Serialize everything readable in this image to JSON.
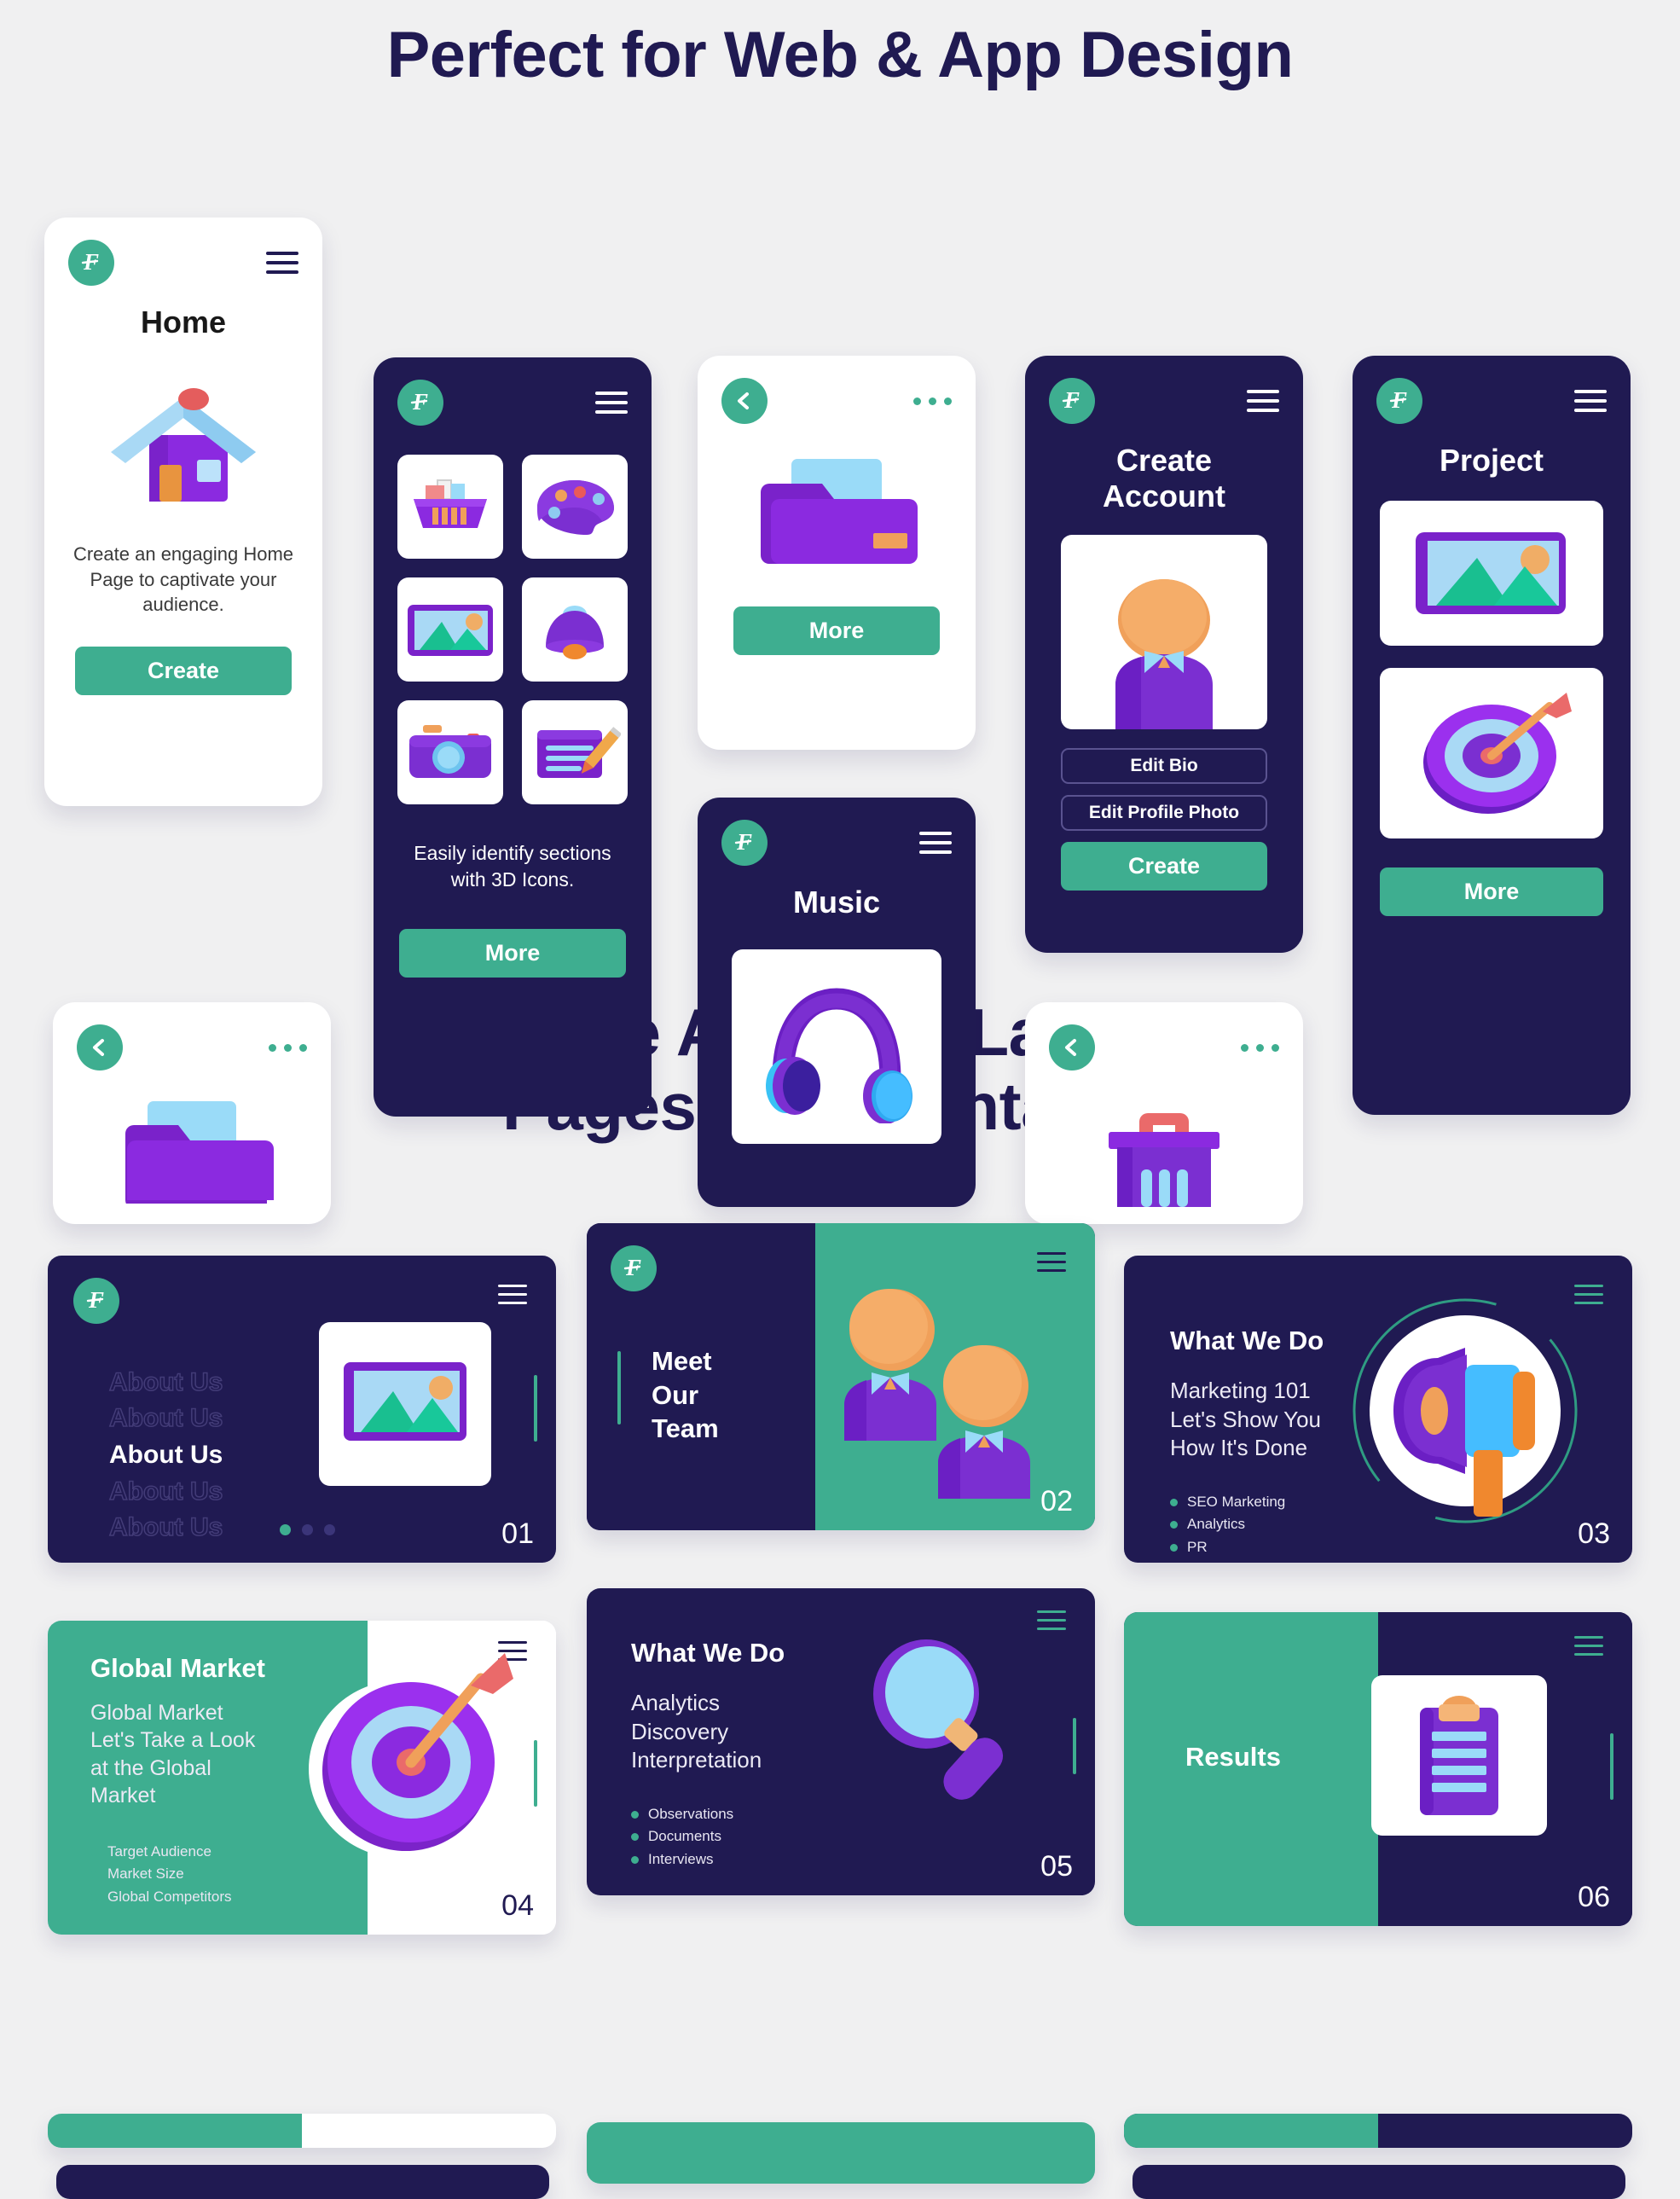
{
  "headings": {
    "primary": "Perfect for Web & App Design",
    "secondary_line1": "Create Amazing Landing",
    "secondary_line2": "Pages & Presentation"
  },
  "colors": {
    "background": "#f0f0f1",
    "navy": "#201a52",
    "teal": "#3eae90",
    "purple": "#7b2fd1",
    "light_blue": "#90d5f7",
    "orange": "#f0a05a",
    "red": "#ea5a5a"
  },
  "brand": {
    "logo_letter": "F"
  },
  "phones": {
    "home": {
      "title": "Home",
      "description": "Create an engaging Home Page to captivate your audience.",
      "button": "Create",
      "icon": "house-3d-icon"
    },
    "icons_grid": {
      "caption": "Easily identify sections with 3D Icons.",
      "button": "More",
      "tiles": [
        {
          "name": "basket-icon"
        },
        {
          "name": "palette-icon"
        },
        {
          "name": "image-icon"
        },
        {
          "name": "bell-icon"
        },
        {
          "name": "camera-icon"
        },
        {
          "name": "note-edit-icon"
        }
      ]
    },
    "folder_top": {
      "button": "More",
      "icon": "folder-3d-icon"
    },
    "folder_bottom": {
      "icon": "folder-3d-icon"
    },
    "music": {
      "title": "Music",
      "icon": "headphones-3d-icon"
    },
    "create_account": {
      "title_line1": "Create",
      "title_line2": "Account",
      "avatar": "person-3d-icon",
      "buttons": [
        {
          "label": "Edit Bio",
          "style": "outline"
        },
        {
          "label": "Edit Profile Photo",
          "style": "outline"
        },
        {
          "label": "Create",
          "style": "solid"
        }
      ]
    },
    "project": {
      "title": "Project",
      "button": "More",
      "tiles": [
        {
          "name": "image-icon"
        },
        {
          "name": "target-arrow-icon"
        }
      ]
    },
    "basket": {
      "icon": "basket-3d-icon"
    }
  },
  "landing_cards": [
    {
      "number": "01",
      "menu_items": [
        "About Us",
        "About Us",
        "About Us",
        "About Us",
        "About Us"
      ],
      "active_index": 2,
      "icon": "image-3d-icon",
      "pager_dots": 3,
      "pager_active": 0
    },
    {
      "number": "02",
      "title_lines": [
        "Meet",
        "Our",
        "Team"
      ],
      "icon": "two-people-3d-icon"
    },
    {
      "number": "03",
      "title": "What We Do",
      "body_lines": [
        "Marketing 101",
        "Let's Show You",
        "How It's Done"
      ],
      "bullets": [
        "SEO Marketing",
        "Analytics",
        "PR"
      ],
      "icon": "megaphone-3d-icon"
    },
    {
      "number": "04",
      "title": "Global Market",
      "body_lines": [
        "Global Market",
        "Let's Take a Look",
        "at the Global",
        "Market"
      ],
      "bullets": [
        "Target Audience",
        "Market Size",
        "Global Competitors"
      ],
      "icon": "target-arrow-3d-icon"
    },
    {
      "number": "05",
      "title": "What We Do",
      "body_lines": [
        "Analytics",
        "Discovery",
        "Interpretation"
      ],
      "bullets": [
        "Observations",
        "Documents",
        "Interviews"
      ],
      "icon": "magnifier-3d-icon"
    },
    {
      "number": "06",
      "title": "Results",
      "icon": "clipboard-3d-icon"
    }
  ]
}
